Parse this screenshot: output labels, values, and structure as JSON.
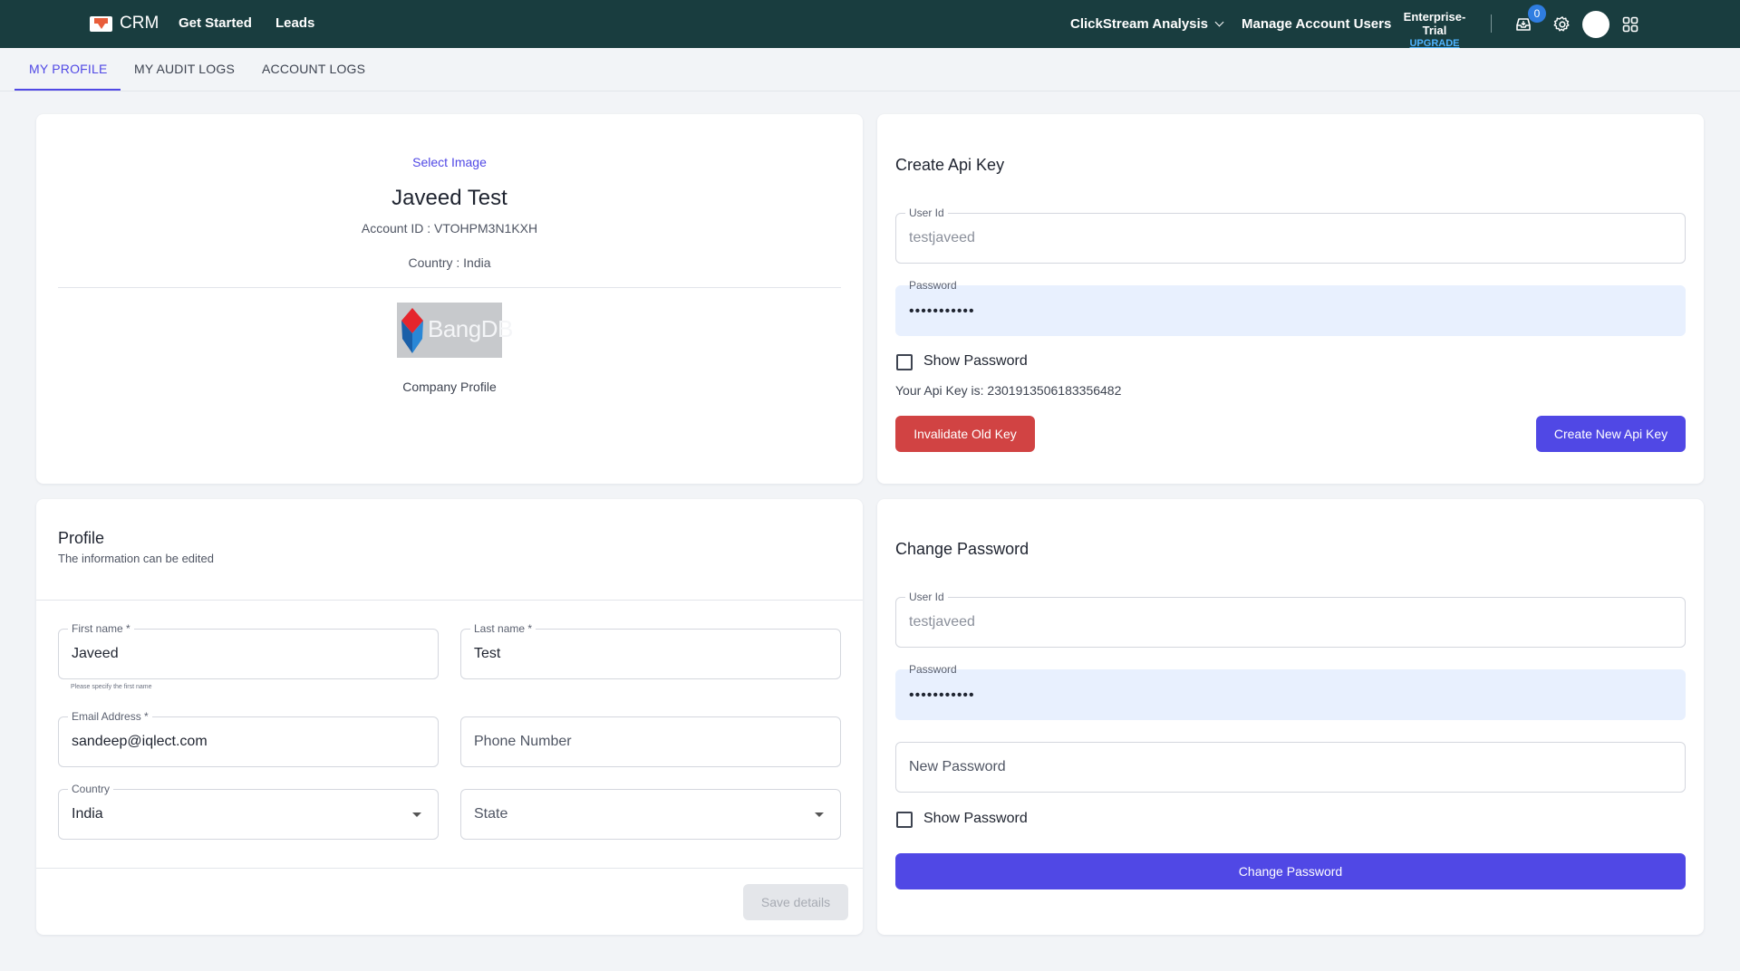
{
  "header": {
    "brand": "CRM",
    "nav": [
      "Get Started",
      "Leads"
    ],
    "dropdown": "ClickStream Analysis",
    "manage_users": "Manage Account Users",
    "plan": "Enterprise-Trial",
    "upgrade": "UPGRADE",
    "notification_count": "0",
    "icons": [
      "inbox-icon",
      "gear-icon",
      "avatar",
      "apps-grid-icon"
    ]
  },
  "tabs": [
    {
      "label": "MY PROFILE",
      "active": true
    },
    {
      "label": "MY AUDIT LOGS",
      "active": false
    },
    {
      "label": "ACCOUNT LOGS",
      "active": false
    }
  ],
  "profile_card": {
    "select_image": "Select Image",
    "name": "Javeed Test",
    "account_id": "Account ID : VTOHPM3N1KXH",
    "country": "Country : India",
    "company_logo_text": "BangDB",
    "company_caption": "Company Profile"
  },
  "api_key": {
    "title": "Create Api Key",
    "user_id_label": "User Id",
    "user_id_value": "testjaveed",
    "password_label": "Password",
    "password_value": "•••••••••••",
    "show_password": "Show Password",
    "api_key_text": "Your Api Key is: 2301913506183356482",
    "invalidate_label": "Invalidate Old Key",
    "create_label": "Create New Api Key"
  },
  "profile_form": {
    "title": "Profile",
    "subtitle": "The information can be edited",
    "first_name_label": "First name *",
    "first_name_value": "Javeed",
    "first_name_helper": "Please specify the first name",
    "last_name_label": "Last name *",
    "last_name_value": "Test",
    "email_label": "Email Address *",
    "email_value": "sandeep@iqlect.com",
    "phone_placeholder": "Phone Number",
    "country_label": "Country",
    "country_value": "India",
    "state_placeholder": "State",
    "save_label": "Save details"
  },
  "change_password": {
    "title": "Change Password",
    "user_id_label": "User Id",
    "user_id_value": "testjaveed",
    "password_label": "Password",
    "password_value": "•••••••••••",
    "new_password_placeholder": "New Password",
    "show_password": "Show Password",
    "submit_label": "Change Password"
  },
  "colors": {
    "header_bg": "#193d3f",
    "accent": "#5048e5",
    "danger": "#d14343",
    "autofill_bg": "#e8f0fe"
  }
}
